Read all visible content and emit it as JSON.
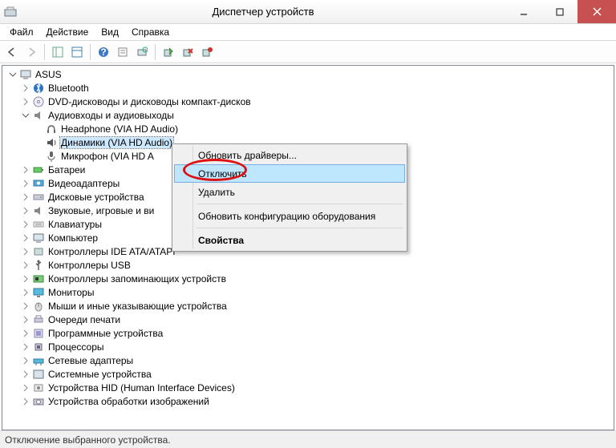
{
  "window": {
    "title": "Диспетчер устройств"
  },
  "menu": {
    "file": "Файл",
    "action": "Действие",
    "view": "Вид",
    "help": "Справка"
  },
  "tree": {
    "root": "ASUS",
    "nodes": {
      "bluetooth": "Bluetooth",
      "dvd": "DVD-дисководы и дисководы компакт-дисков",
      "audio_io": "Аудиовходы и аудиовыходы",
      "headphone": "Headphone (VIA HD Audio)",
      "speakers": "Динамики (VIA HD Audio)",
      "mic": "Микрофон (VIA HD A",
      "batteries": "Батареи",
      "display_adapters": "Видеоадаптеры",
      "disk_drives": "Дисковые устройства",
      "sound_game": "Звуковые, игровые и ви",
      "keyboards": "Клавиатуры",
      "computer": "Компьютер",
      "ide_ata": "Контроллеры IDE ATA/ATAPI",
      "usb_controllers": "Контроллеры USB",
      "storage_controllers": "Контроллеры запоминающих устройств",
      "monitors": "Мониторы",
      "mice": "Мыши и иные указывающие устройства",
      "print_queues": "Очереди печати",
      "software": "Программные устройства",
      "processors": "Процессоры",
      "net_adapters": "Сетевые адаптеры",
      "system_devices": "Системные устройства",
      "hid": "Устройства HID (Human Interface Devices)",
      "imaging": "Устройства обработки изображений"
    }
  },
  "ctx": {
    "update_drivers": "Обновить драйверы...",
    "disable": "Отключить",
    "remove": "Удалить",
    "scan": "Обновить конфигурацию оборудования",
    "properties": "Свойства"
  },
  "status": "Отключение выбранного устройства."
}
